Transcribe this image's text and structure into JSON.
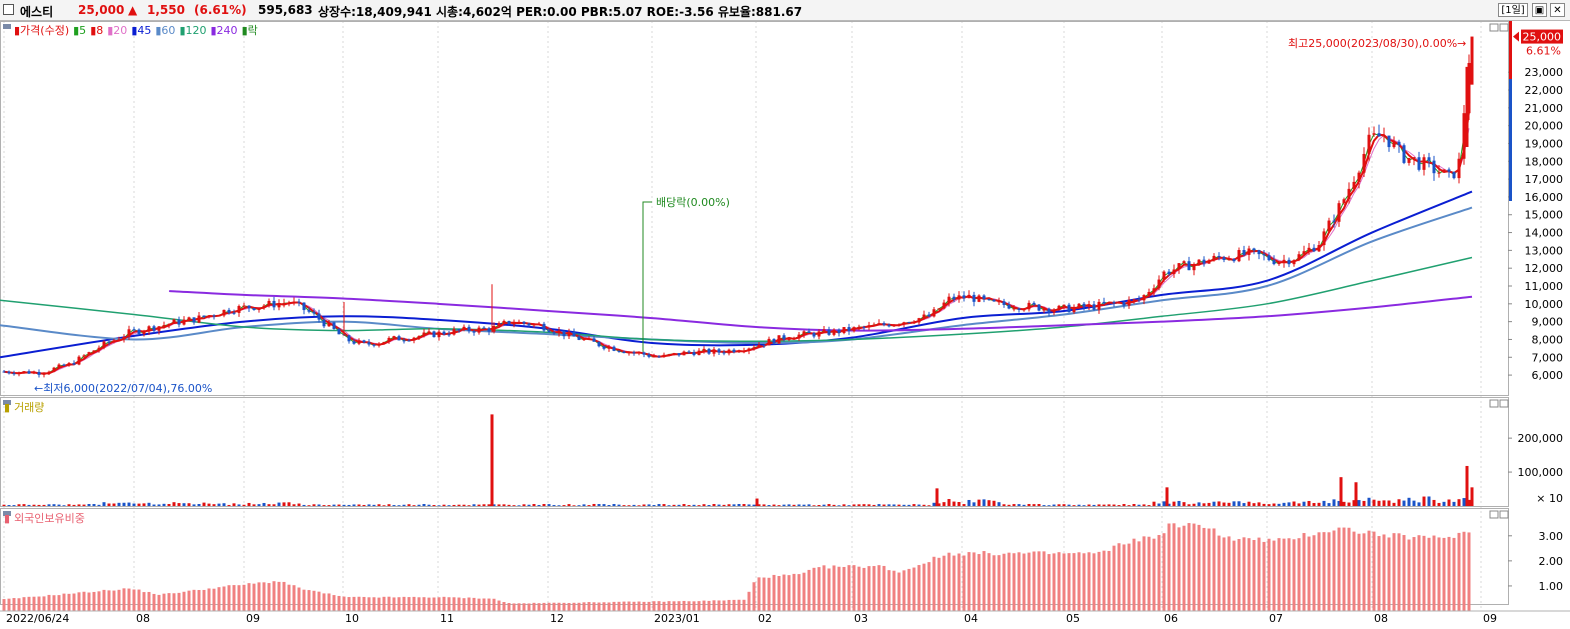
{
  "header": {
    "stock_name": "에스티",
    "price": "25,000",
    "change_arrow": "▲",
    "change": "1,550",
    "change_pct": "(6.61%)",
    "volume": "595,683",
    "info": "상장수:18,409,941 시총:4,602억 PER:0.00 PBR:5.07 ROE:-3.56 유보율:881.67",
    "period_button": "[1일]",
    "restore_icon": "▣",
    "close_icon": "✕"
  },
  "price_panel": {
    "legend": [
      {
        "label": "가격(수정)",
        "color": "#e01010"
      },
      {
        "label": "5",
        "color": "#1fa01f"
      },
      {
        "label": "8",
        "color": "#e01010"
      },
      {
        "label": "20",
        "color": "#e070c8"
      },
      {
        "label": "45",
        "color": "#0a1ed2"
      },
      {
        "label": "60",
        "color": "#5a8ac8"
      },
      {
        "label": "120",
        "color": "#20a070"
      },
      {
        "label": "240",
        "color": "#8a2ae0"
      },
      {
        "label": "락",
        "color": "#208a20"
      }
    ],
    "y_axis": [
      "6,000",
      "7,000",
      "8,000",
      "9,000",
      "10,000",
      "11,000",
      "12,000",
      "13,000",
      "14,000",
      "15,000",
      "16,000",
      "17,000",
      "18,000",
      "19,000",
      "20,000",
      "21,000",
      "22,000",
      "23,000"
    ],
    "current_price_label": "25,000",
    "current_pct_label": "6.61%",
    "high_annotation": "최고25,000(2023/08/30),0.00%→",
    "low_annotation": "←최저6,000(2022/07/04),76.00%",
    "dividend_annotation": "배당락(0.00%)"
  },
  "volume_panel": {
    "title": "거래량",
    "y_axis": [
      "200,000",
      "100,000",
      "× 10"
    ]
  },
  "foreign_panel": {
    "title": "외국인보유비중",
    "y_axis": [
      "3.00",
      "2.00",
      "1.00"
    ]
  },
  "x_axis": [
    "2022/06/24",
    "08",
    "09",
    "10",
    "11",
    "12",
    "2023/01",
    "02",
    "03",
    "04",
    "05",
    "06",
    "07",
    "08",
    "09"
  ],
  "chart_data": {
    "type": "candlestick",
    "series": [
      {
        "name": "가격(수정)",
        "months": [
          "2022/06/24",
          "08",
          "09",
          "10",
          "11",
          "12",
          "2023/01",
          "02",
          "03",
          "04",
          "05",
          "06",
          "07",
          "08",
          "09"
        ],
        "approx_close": [
          6200,
          8800,
          10000,
          8200,
          8300,
          8700,
          7100,
          7800,
          8700,
          10300,
          9800,
          12500,
          12600,
          17800,
          25000
        ]
      },
      {
        "name": "45",
        "approx": [
          7000,
          8200,
          9000,
          9300,
          9100,
          8600,
          7800,
          7700,
          8100,
          9200,
          9600,
          10500,
          11300,
          14000,
          16300
        ]
      },
      {
        "name": "60",
        "approx": [
          8800,
          8000,
          8700,
          9000,
          8600,
          8300,
          8000,
          7800,
          8000,
          8800,
          9400,
          10200,
          11000,
          13500,
          15400
        ]
      },
      {
        "name": "120",
        "approx": [
          10200,
          9400,
          8700,
          8500,
          8600,
          8400,
          8000,
          7900,
          8000,
          8300,
          8700,
          9300,
          10000,
          11300,
          12600
        ]
      },
      {
        "name": "240",
        "approx": [
          10700,
          10700,
          10500,
          10300,
          10000,
          9600,
          9200,
          8700,
          8500,
          8600,
          8800,
          9000,
          9300,
          9800,
          10400
        ]
      }
    ],
    "volume_peak": 270000,
    "foreign_ratio_range": [
      0.3,
      3.4
    ]
  }
}
